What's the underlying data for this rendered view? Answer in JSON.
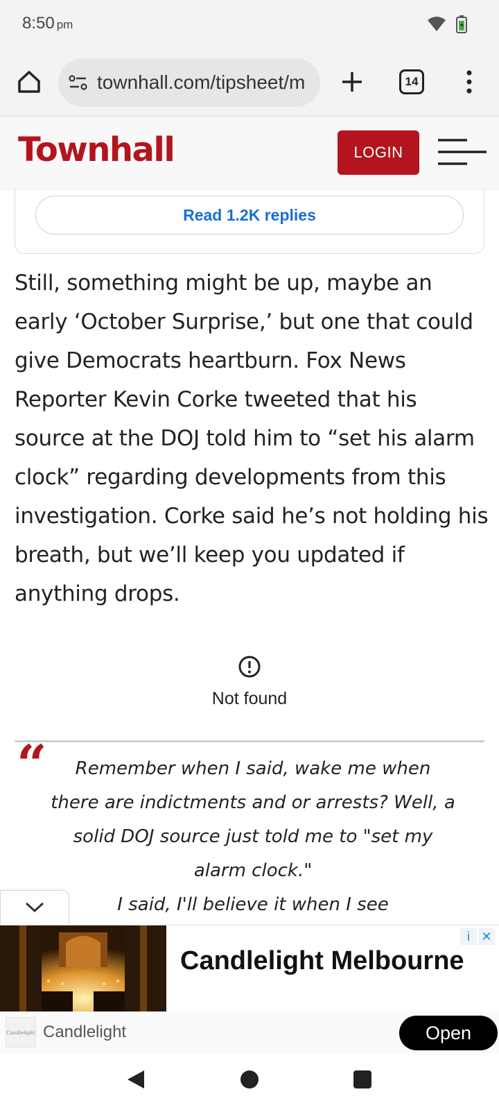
{
  "status_bar": {
    "time": "8:50",
    "ampm": "pm",
    "icons": [
      "wifi-icon",
      "battery-icon"
    ]
  },
  "browser": {
    "url": "townhall.com/tipsheet/m",
    "tab_count": "14",
    "icons": [
      "home-icon",
      "site-settings-icon",
      "plus-icon",
      "tabs-icon",
      "more-vert-icon"
    ]
  },
  "header": {
    "logo": "Townhall",
    "login_label": "LOGIN",
    "brand_color": "#b3141d"
  },
  "comments": {
    "replies_label": "Read 1.2K replies",
    "link_color": "#1a6fd0"
  },
  "article": {
    "paragraph": "Still, something might be up, maybe an early ‘October Surprise,’ but one that could give Democrats heartburn. Fox News Reporter Kevin Corke tweeted that his source at the DOJ told him to “set his alarm clock” regarding developments from this investigation. Corke said he’s not holding his breath, but we’ll keep you updated if anything drops."
  },
  "embed_error": {
    "text": "Not found"
  },
  "tweet": {
    "quote_mark": "“",
    "line1": "Remember when I said, wake me when there are indictments and or arrests? Well, a solid DOJ source just told me to \"set my alarm clock.\"",
    "line2": "I said, I'll believe it when I see"
  },
  "ad": {
    "title": "Candlelight Melbourne",
    "advertiser": "Candlelight",
    "logo_text": "Candlelight",
    "open_label": "Open",
    "choices": [
      "i",
      "✕"
    ]
  },
  "nav": {
    "icons": [
      "back-icon",
      "home-circle-icon",
      "recents-icon"
    ]
  }
}
